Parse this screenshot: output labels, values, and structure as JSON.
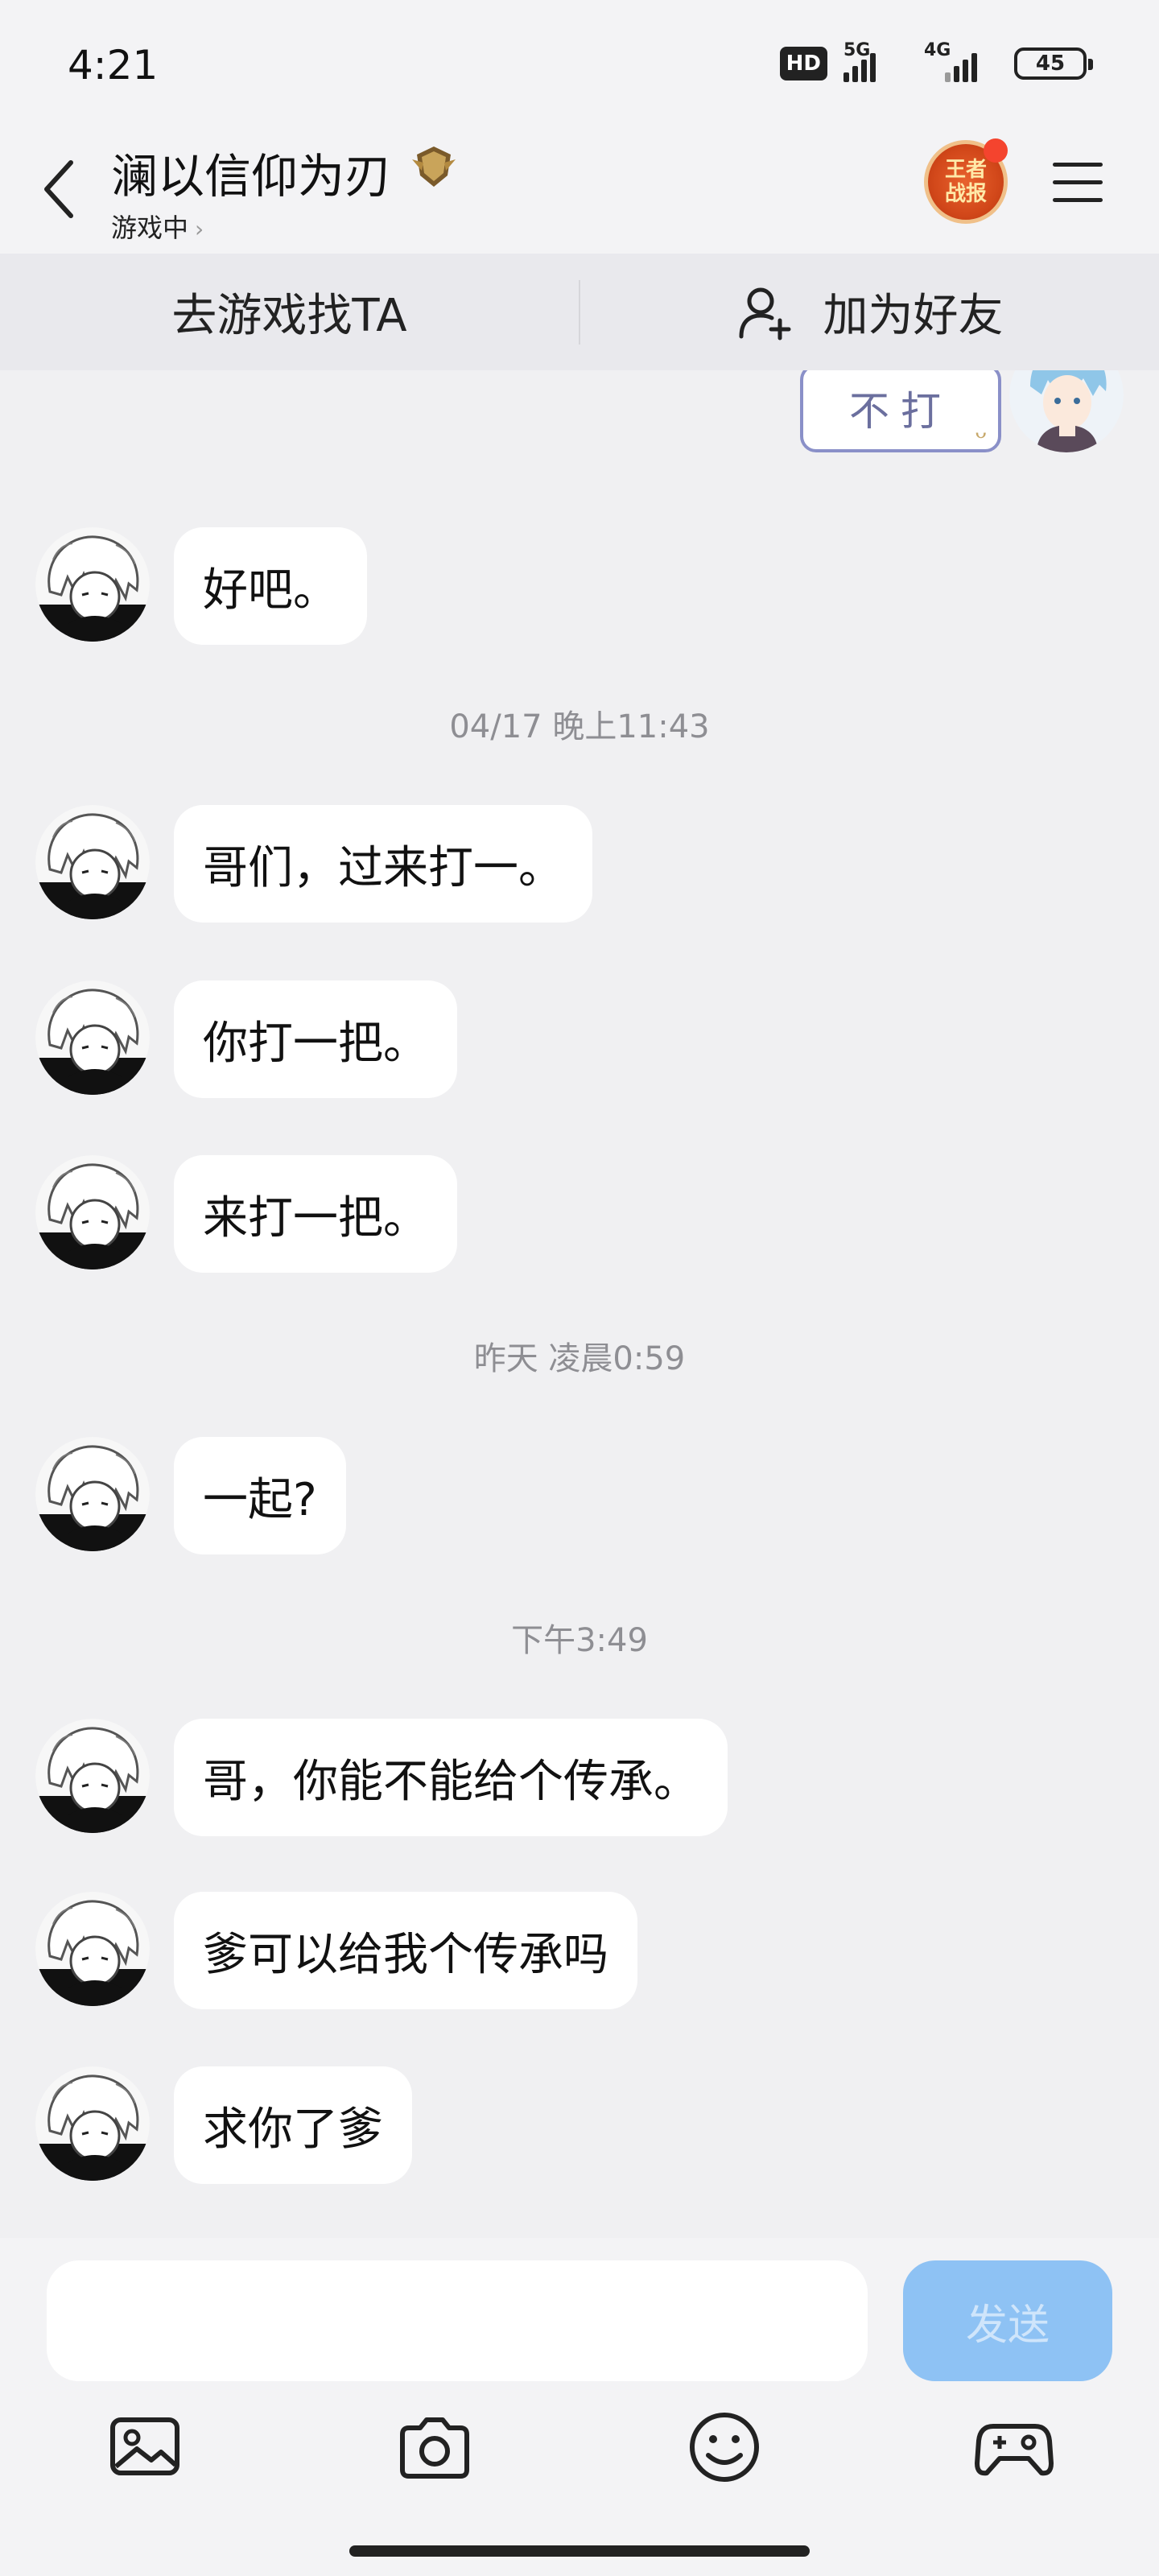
{
  "status_bar": {
    "time": "4:21",
    "hd_badge": "HD",
    "net1": "5G",
    "net2": "4G",
    "battery": "45"
  },
  "header": {
    "contact_name": "澜以信仰为刃",
    "contact_status": "游戏中",
    "report_badge": "王者战报",
    "back_icon": "chevron-left-icon",
    "menu_icon": "hamburger-menu-icon"
  },
  "actions": {
    "find_in_game": "去游戏找TA",
    "add_friend": "加为好友"
  },
  "chat": {
    "sticker_text": "不打",
    "items": [
      {
        "type": "message",
        "text": "好吧。"
      },
      {
        "type": "timestamp",
        "text": "04/17 晚上11:43"
      },
      {
        "type": "message",
        "text": "哥们，过来打一。"
      },
      {
        "type": "message",
        "text": "你打一把。"
      },
      {
        "type": "message",
        "text": "来打一把。"
      },
      {
        "type": "timestamp",
        "text": "昨天 凌晨0:59"
      },
      {
        "type": "message",
        "text": "一起?"
      },
      {
        "type": "timestamp",
        "text": "下午3:49"
      },
      {
        "type": "message",
        "text": "哥，你能不能给个传承。"
      },
      {
        "type": "message",
        "text": "爹可以给我个传承吗"
      },
      {
        "type": "message",
        "text": "求你了爹"
      }
    ]
  },
  "composer": {
    "input_value": "",
    "send_label": "发送"
  },
  "toolbar": {
    "icons": [
      "image-icon",
      "camera-icon",
      "emoji-icon",
      "gamepad-icon"
    ]
  },
  "colors": {
    "background": "#f0f0f2",
    "bubble": "#ffffff",
    "send_button": "#8ec2f4",
    "timestamp": "#8e8e93"
  }
}
